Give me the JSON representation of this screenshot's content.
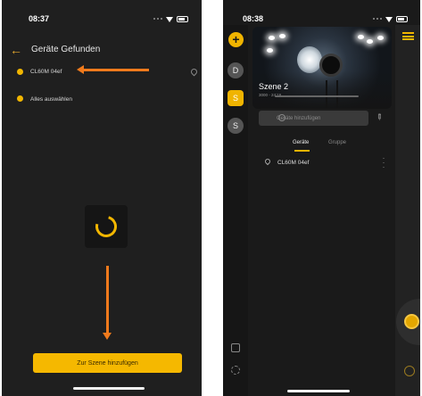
{
  "phone1": {
    "status": {
      "time": "08:37"
    },
    "header": {
      "title": "Geräte Gefunden"
    },
    "list": [
      {
        "label": "CL60M 04ef"
      },
      {
        "label": "Alles auswählen"
      }
    ],
    "add_to_scene_label": "Zur Szene hinzufügen"
  },
  "phone2": {
    "status": {
      "time": "08:38"
    },
    "rail": {
      "add": "+",
      "tabs": [
        "D",
        "S",
        "S"
      ]
    },
    "scene": {
      "name": "Szene 2",
      "subtitle": "3000 - 24:16"
    },
    "add_devices_label": "Geräte hinzufügen",
    "tabs": [
      "Geräte",
      "Gruppe"
    ],
    "device": {
      "name": "CL60M 04ef"
    }
  },
  "colors": {
    "accent": "#f2b600",
    "annotation_arrow": "#f07a1c",
    "background": "#1f1f1f"
  },
  "icons": [
    "back-arrow-icon",
    "location-pin-icon",
    "spinner-icon",
    "plus-icon",
    "bulb-icon",
    "edit-icon",
    "menu-icon",
    "power-icon",
    "kebab-icon"
  ]
}
